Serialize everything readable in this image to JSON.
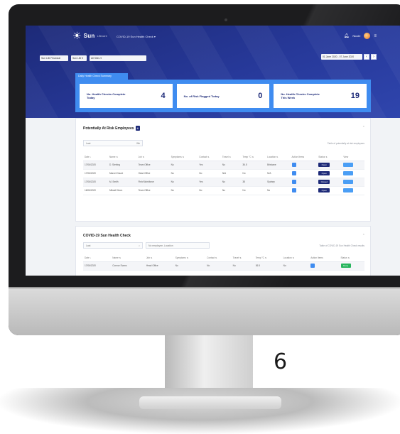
{
  "nav": {
    "logo_text": "Sun",
    "logo_sub": "Lifecare",
    "title": "COVID-19 Sun Health Check ▾",
    "user_name": "Nicole"
  },
  "filters": {
    "company": "Sun Life Financial",
    "division": "Sun Life ▾",
    "location": "All Sites ▾",
    "date_range": "01 June 2020 - 07 June 2020"
  },
  "stats": {
    "tab_label": "Daily Health Check Summary",
    "cards": [
      {
        "label": "No. Health Checks Complete Today",
        "value": "4"
      },
      {
        "label": "No. of Risk Flagged Today",
        "value": "0"
      },
      {
        "label": "No. Health Checks Complete This Week",
        "value": "19"
      }
    ]
  },
  "panel1": {
    "title": "Potentially At Risk Employees",
    "badge": "4",
    "close": "×",
    "filter_value": "Last",
    "filter_unit": "Wk",
    "note": "Table of potentially at risk employees",
    "columns": [
      "Date ↓",
      "Name ⇅",
      "Job ⇅",
      "Symptoms ⇅",
      "Contact ⇅",
      "Travel ⇅",
      "Temp °C ⇅",
      "Location ⇅",
      "Action Items",
      "Status ⇅",
      "View"
    ],
    "rows": [
      [
        "17/06/2020",
        "D. Sterling",
        "Team Office",
        "No",
        "Yes",
        "No",
        "36.5",
        "Brisbane",
        "",
        "Open",
        ""
      ],
      [
        "17/06/2020",
        "Marcel Gaunt",
        "Head Office",
        "No",
        "No",
        "N/A",
        "No",
        "N/A",
        "",
        "Open",
        ""
      ],
      [
        "17/06/2020",
        "M. Smith",
        "Field Workforce",
        "No",
        "Yes",
        "No",
        "38",
        "Sydney",
        "",
        "Closed",
        ""
      ],
      [
        "16/06/2020",
        "Mikael Dixon",
        "Team Office",
        "No",
        "No",
        "No",
        "No",
        "No",
        "",
        "Open",
        ""
      ]
    ]
  },
  "panel2": {
    "title": "COVID-19 Sun Health Check",
    "close": "×",
    "filter_value": "Last",
    "search_placeholder": "No employee, Location",
    "note": "Table of COVID-19 Sun Health Check results",
    "columns": [
      "Date ↓",
      "Name ⇅",
      "Job ⇅",
      "Symptoms ⇅",
      "Contact ⇅",
      "Travel ⇅",
      "Temp °C ⇅",
      "Location ⇅",
      "Action Items",
      "Status ⇅"
    ],
    "rows": [
      [
        "17/06/2020",
        "Connor Evans",
        "Head Office",
        "No",
        "No",
        "No",
        "36.5",
        "No",
        "",
        "Done"
      ]
    ]
  },
  "page_number": "6"
}
